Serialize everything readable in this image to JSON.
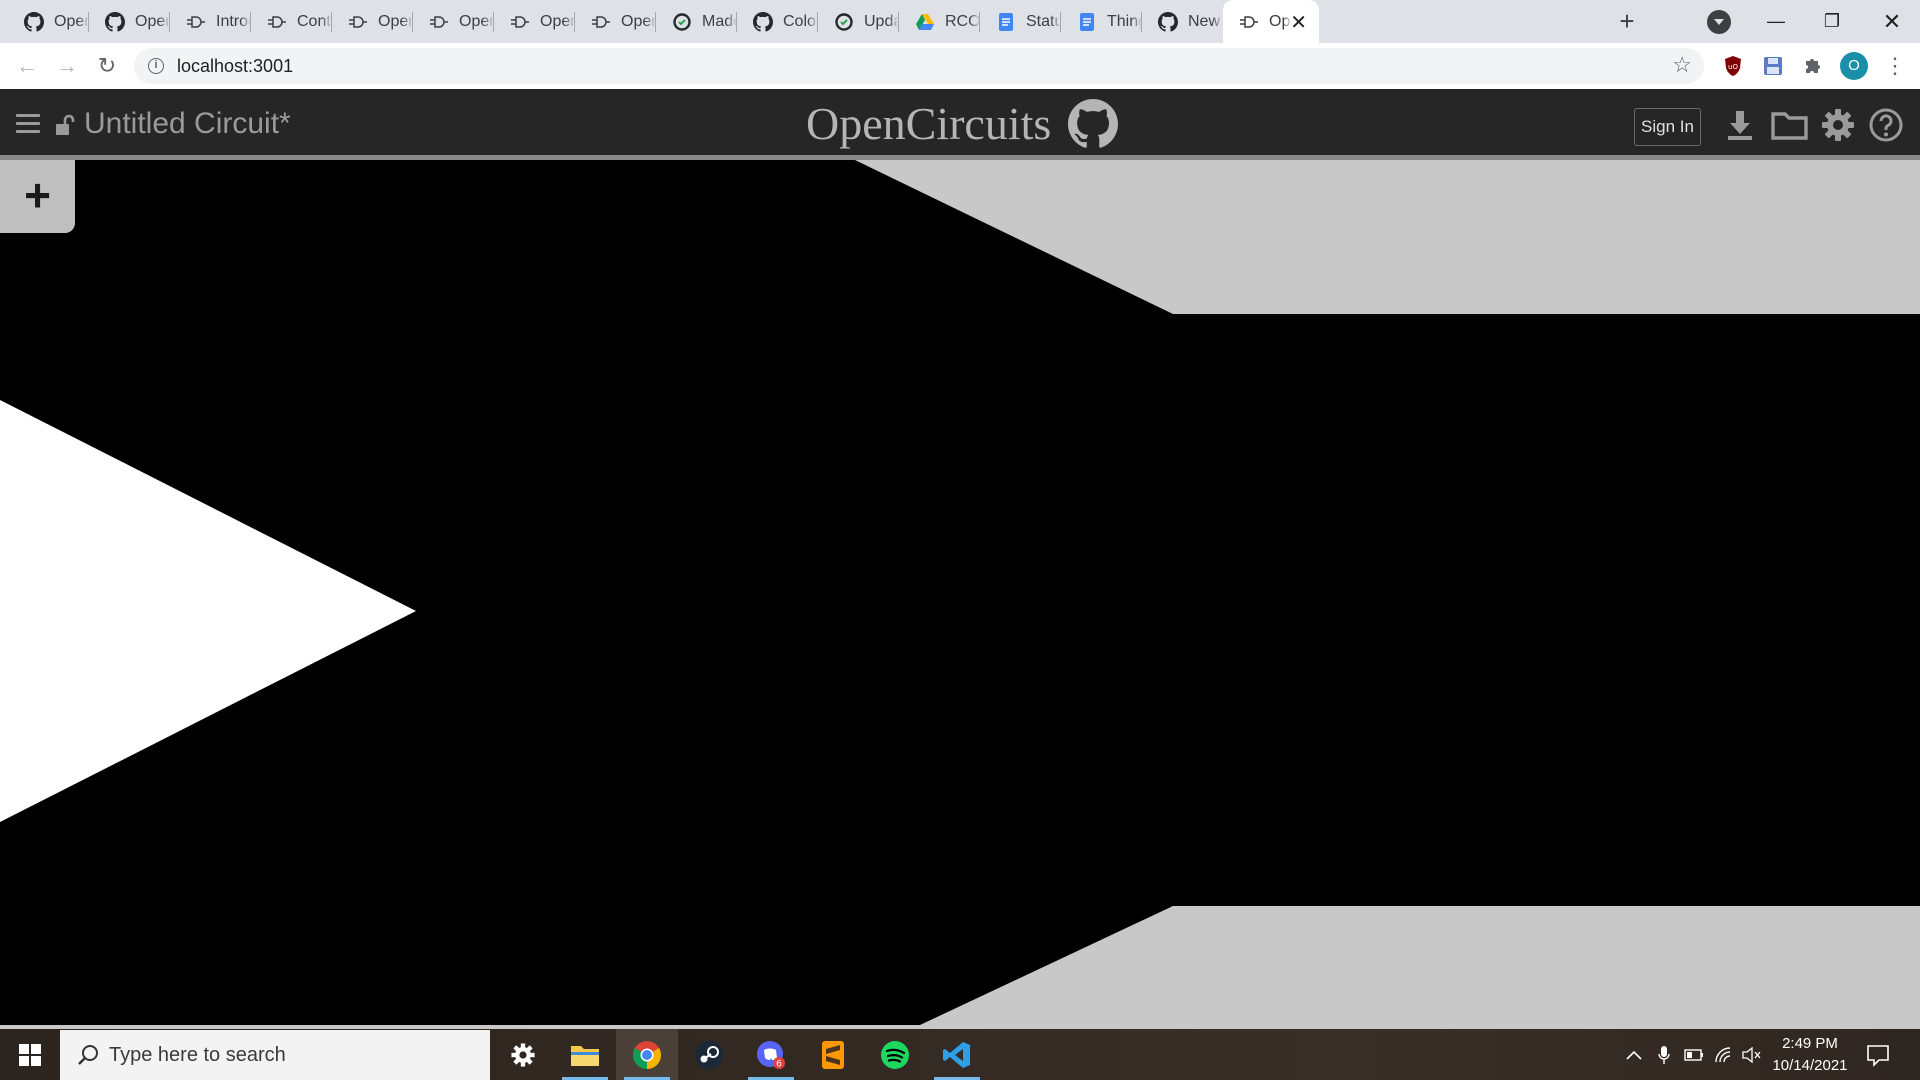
{
  "browser": {
    "tabs": [
      {
        "label": "OpenCircuits",
        "icon": "github-icon"
      },
      {
        "label": "OpenCircuits",
        "icon": "github-icon"
      },
      {
        "label": "Introduction",
        "icon": "gate-icon"
      },
      {
        "label": "Contributing",
        "icon": "gate-icon"
      },
      {
        "label": "Open C",
        "icon": "gate-icon"
      },
      {
        "label": "Open C",
        "icon": "gate-icon"
      },
      {
        "label": "Open C",
        "icon": "gate-icon"
      },
      {
        "label": "Open C",
        "icon": "gate-icon"
      },
      {
        "label": "Made t",
        "icon": "github-status-icon"
      },
      {
        "label": "Color c",
        "icon": "github-icon"
      },
      {
        "label": "Update",
        "icon": "github-status-icon"
      },
      {
        "label": "RCOS -",
        "icon": "drive-icon"
      },
      {
        "label": "Status",
        "icon": "docs-icon"
      },
      {
        "label": "Things",
        "icon": "docs-icon"
      },
      {
        "label": "New Iss",
        "icon": "github-icon"
      },
      {
        "label": "Ope",
        "icon": "gate-icon",
        "active": true
      }
    ],
    "url": "localhost:3001",
    "profile_initial": "O"
  },
  "app": {
    "circuit_name": "Untitled Circuit*",
    "brand": "OpenCircuits",
    "sign_in_label": "Sign In",
    "add_button_label": "+"
  },
  "taskbar": {
    "search_placeholder": "Type here to search",
    "time": "2:49 PM",
    "date": "10/14/2021",
    "discord_badge": "6"
  },
  "colors": {
    "header_bg": "#262626",
    "canvas_bg": "#c8c8c8",
    "gate_fill": "#000000",
    "selection_fill": "#ffffff",
    "accent": "#76b9ed"
  }
}
